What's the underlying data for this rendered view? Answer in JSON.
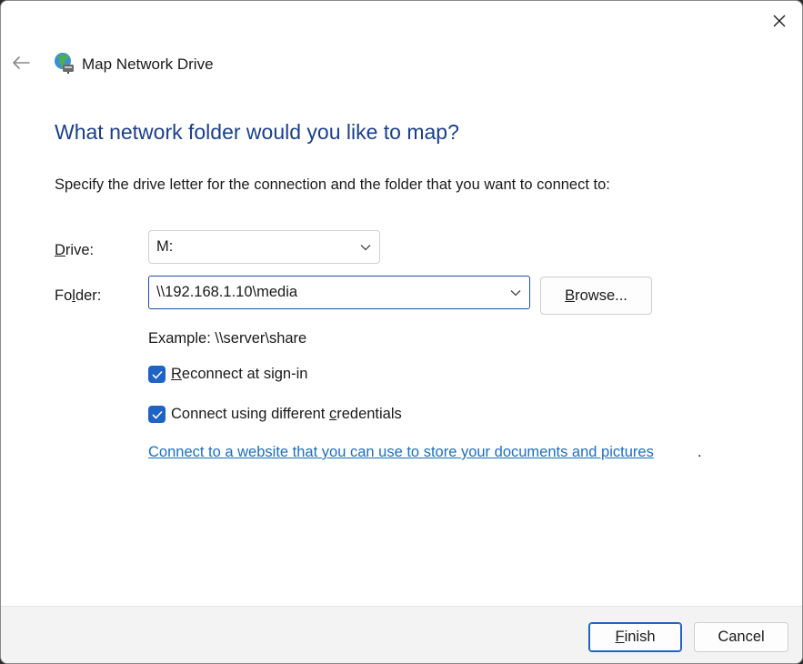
{
  "window": {
    "title": "Map Network Drive",
    "icons": {
      "back": "back-arrow-icon",
      "close": "close-icon",
      "app": "network-drive-icon"
    }
  },
  "main": {
    "heading": "What network folder would you like to map?",
    "instruction": "Specify the drive letter for the connection and the folder that you want to connect to:",
    "drive": {
      "label_accel": "D",
      "label_rest": "rive:",
      "value": "M:"
    },
    "folder": {
      "label_pre": "Fo",
      "label_accel": "l",
      "label_rest": "der:",
      "value": "\\\\192.168.1.10\\media"
    },
    "browse": {
      "accel": "B",
      "rest": "rowse..."
    },
    "example": "Example: \\\\server\\share",
    "reconnect": {
      "accel": "R",
      "rest": "econnect at sign-in",
      "checked": true
    },
    "credentials": {
      "pre": "Connect using different ",
      "accel": "c",
      "rest": "redentials",
      "checked": true
    },
    "link": "Connect to a website that you can use to store your documents and pictures",
    "link_suffix": "."
  },
  "footer": {
    "finish": {
      "accel": "F",
      "rest": "inish"
    },
    "cancel": "Cancel"
  },
  "colors": {
    "accent": "#1f63c6",
    "heading": "#1a3f8f",
    "link": "#1a6fc2"
  }
}
